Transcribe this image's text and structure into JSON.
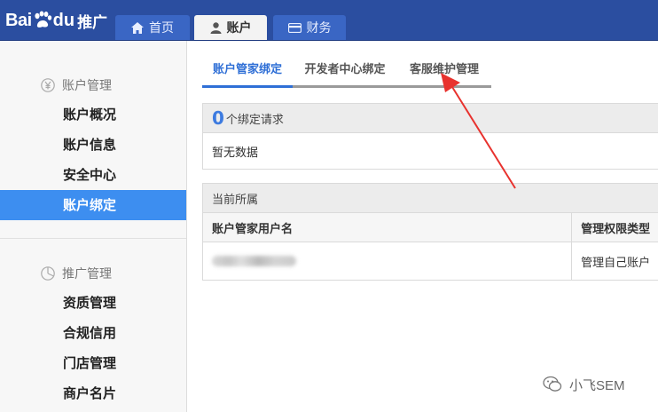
{
  "header": {
    "logo_bai": "Bai",
    "logo_du": "du",
    "logo_cn": "推广",
    "tabs": [
      {
        "label": "首页",
        "icon": "home-icon"
      },
      {
        "label": "账户",
        "icon": "user-icon"
      },
      {
        "label": "财务",
        "icon": "card-icon"
      }
    ]
  },
  "sidebar": {
    "section1": {
      "title": "账户管理",
      "icon": "yen-icon"
    },
    "items1": [
      {
        "label": "账户概况"
      },
      {
        "label": "账户信息"
      },
      {
        "label": "安全中心"
      },
      {
        "label": "账户绑定"
      }
    ],
    "section2": {
      "title": "推广管理",
      "icon": "pie-chart-icon"
    },
    "items2": [
      {
        "label": "资质管理"
      },
      {
        "label": "合规信用"
      },
      {
        "label": "门店管理"
      },
      {
        "label": "商户名片"
      }
    ]
  },
  "subtabs": [
    {
      "label": "账户管家绑定"
    },
    {
      "label": "开发者中心绑定"
    },
    {
      "label": "客服维护管理"
    }
  ],
  "requests": {
    "count": "0",
    "suffix": "个绑定请求",
    "empty_text": "暂无数据"
  },
  "current": {
    "title": "当前所属",
    "columns": [
      "账户管家用户名",
      "管理权限类型"
    ],
    "rows": [
      {
        "permission": "管理自己账户"
      }
    ]
  },
  "watermark": {
    "text": "小飞SEM"
  },
  "colors": {
    "header_bg": "#2b4ea0",
    "active_blue": "#3d8ef0",
    "arrow_red": "#e8322e"
  }
}
